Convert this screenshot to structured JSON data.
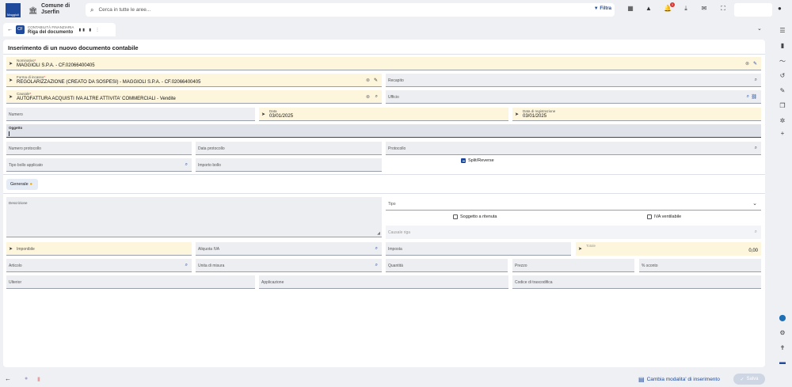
{
  "header": {
    "logo_text": "Maggioli",
    "comune_line1": "Comune di",
    "comune_line2": "Jserfin",
    "search_placeholder": "Cerca in tutte le aree...",
    "filter_label": "Filtra",
    "notification_count": "1"
  },
  "tab": {
    "subtitle": "CONTABILITÀ FINANZIARIA",
    "title": "Riga del documento",
    "icon_text": "CF"
  },
  "panel": {
    "title": "Inserimento di un nuovo documento contabile"
  },
  "fields": {
    "nominativo": {
      "label": "Nominativo",
      "value": "MAGGIOLI S.P.A. - CF.02066400405"
    },
    "forma": {
      "label": "Forma di incasso",
      "value": "REGOLARIZZAZIONE (CREATO DA SOSPESI) - MAGGIOLI S.P.A. - CF.02066400405"
    },
    "recapito": {
      "label": "Recapito"
    },
    "causale": {
      "label": "Causale",
      "value": "AUTOFATTURA ACQUISTI IVA ALTRE ATTIVITA' COMMERCIALI - Vendite"
    },
    "ufficio": {
      "label": "Ufficio"
    },
    "numero": {
      "label": "Numero"
    },
    "data": {
      "label": "Data",
      "value": "03/01/2025"
    },
    "data_reg": {
      "label": "Data di registrazione",
      "value": "03/01/2025"
    },
    "oggetto": {
      "label": "Oggetto"
    },
    "num_prot": {
      "label": "Numero protocollo"
    },
    "data_prot": {
      "label": "Data protocollo"
    },
    "protocollo": {
      "label": "Protocollo"
    },
    "tipo_bollo": {
      "label": "Tipo bollo applicato"
    },
    "importo_bollo": {
      "label": "Importo bollo"
    },
    "split": {
      "label": "Split/Reverse"
    }
  },
  "section_tab": {
    "label": "Generale"
  },
  "detail": {
    "descrizione": {
      "label": "Descrizione"
    },
    "tipo": {
      "label": "Tipo"
    },
    "soggetto_ritenuta": {
      "label": "Soggetto a ritenuta"
    },
    "iva_ventilabile": {
      "label": "IVA ventilabile"
    },
    "causale_riga": {
      "label": "Causale riga"
    },
    "imponibile": {
      "label": "Imponibile"
    },
    "aliquota": {
      "label": "Aliquota IVA"
    },
    "imposta": {
      "label": "Imposta"
    },
    "totale": {
      "label": "Totale",
      "value": "0,00"
    },
    "articolo": {
      "label": "Articolo"
    },
    "unita": {
      "label": "Unita di misura"
    },
    "quantita": {
      "label": "Quantità"
    },
    "prezzo": {
      "label": "Prezzo"
    },
    "sconto": {
      "label": "% sconto"
    },
    "ulteriori": {
      "label": "Ulterior"
    },
    "applicazione": {
      "label": "Applicazione"
    },
    "trascodifica": {
      "label": "Codice di trascodifica"
    }
  },
  "footer": {
    "cambia_label": "Cambia modalita' di inserimento",
    "salva_label": "Salva"
  },
  "colors": {
    "accent": "#1f4a9c",
    "required_bg": "#fdf6dd",
    "field_bg": "#eceef2"
  }
}
